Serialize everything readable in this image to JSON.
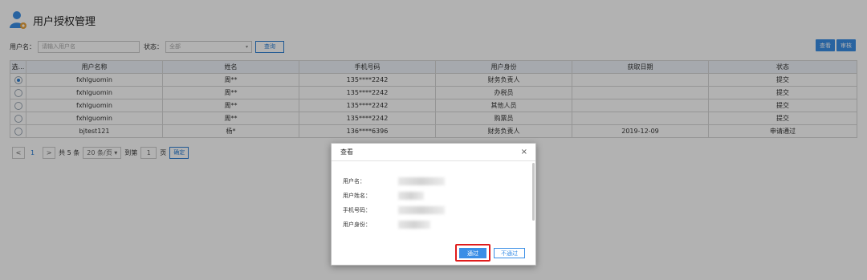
{
  "header": {
    "title": "用户授权管理",
    "icon": "user-gear-icon"
  },
  "filter": {
    "username_label": "用户名：",
    "username_placeholder": "请输入用户名",
    "status_label": "状态：",
    "status_value": "全部",
    "query_label": "查询"
  },
  "actions": {
    "view_label": "查看",
    "review_label": "审核"
  },
  "table": {
    "columns": [
      "选...",
      "用户名称",
      "姓名",
      "手机号码",
      "用户身份",
      "获取日期",
      "状态"
    ],
    "rows": [
      {
        "selected": true,
        "username": "fxhlguomin",
        "name": "周**",
        "phone": "135****2242",
        "role": "财务负责人",
        "date": "",
        "status": "提交"
      },
      {
        "selected": false,
        "username": "fxhlguomin",
        "name": "周**",
        "phone": "135****2242",
        "role": "办税员",
        "date": "",
        "status": "提交"
      },
      {
        "selected": false,
        "username": "fxhlguomin",
        "name": "周**",
        "phone": "135****2242",
        "role": "其他人员",
        "date": "",
        "status": "提交"
      },
      {
        "selected": false,
        "username": "fxhlguomin",
        "name": "周**",
        "phone": "135****2242",
        "role": "购票员",
        "date": "",
        "status": "提交"
      },
      {
        "selected": false,
        "username": "bjtest121",
        "name": "杨*",
        "phone": "136****6396",
        "role": "财务负责人",
        "date": "2019-12-09",
        "status": "申请通过"
      }
    ]
  },
  "pager": {
    "prev": "<",
    "current": "1",
    "next": ">",
    "total_text": "共 5 条",
    "page_size": "20 条/页 ▾",
    "goto_label": "到第",
    "page_input": "1",
    "page_unit": "页",
    "confirm_label": "确定"
  },
  "dialog": {
    "title": "查看",
    "close": "×",
    "fields": [
      {
        "label": "用户名："
      },
      {
        "label": "用户姓名："
      },
      {
        "label": "手机号码："
      },
      {
        "label": "用户身份："
      }
    ],
    "pass_label": "通过",
    "reject_label": "不通过"
  },
  "colors": {
    "accent": "#3a8ee6",
    "highlight": "#e01b1b"
  }
}
